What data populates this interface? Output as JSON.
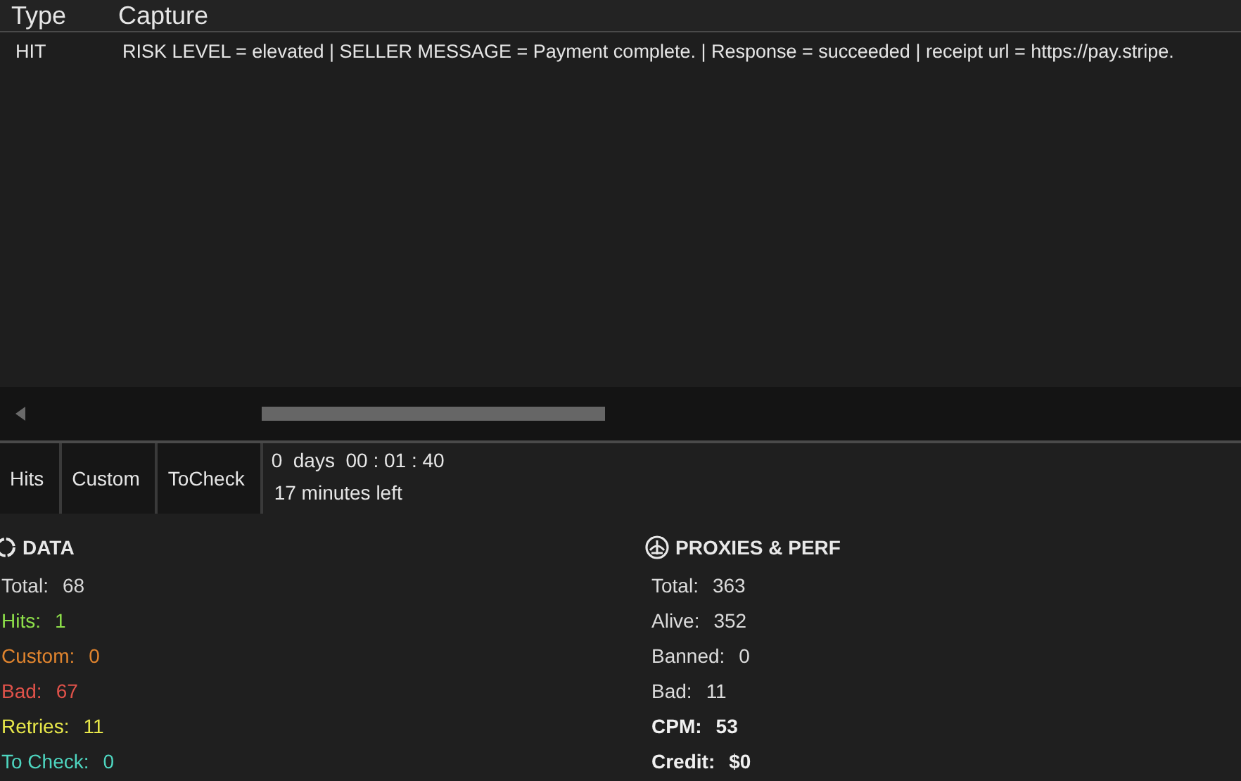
{
  "table": {
    "columns": [
      "Type",
      "Capture"
    ],
    "rows": [
      {
        "type": "HIT",
        "capture": "RISK LEVEL = elevated | SELLER MESSAGE = Payment complete. | Response = succeeded | receipt url = https://pay.stripe."
      }
    ]
  },
  "tabs": [
    "Hits",
    "Custom",
    "ToCheck"
  ],
  "timer": {
    "elapsed": "0  days  00 : 01 : 40",
    "remaining": "17 minutes left"
  },
  "data": {
    "title": "DATA",
    "stats": [
      {
        "label": "Total:",
        "value": "68",
        "color": "#d8d8d8"
      },
      {
        "label": "Hits:",
        "value": "1",
        "color": "#8ee04a"
      },
      {
        "label": "Custom:",
        "value": "0",
        "color": "#e0842e"
      },
      {
        "label": "Bad:",
        "value": "67",
        "color": "#e0524a"
      },
      {
        "label": "Retries:",
        "value": "11",
        "color": "#e8e84a"
      },
      {
        "label": "To Check:",
        "value": "0",
        "color": "#4ed6c0"
      }
    ]
  },
  "proxies": {
    "title": "PROXIES & PERF",
    "stats": [
      {
        "label": "Total:",
        "value": "363",
        "bold": false
      },
      {
        "label": "Alive:",
        "value": "352",
        "bold": false
      },
      {
        "label": "Banned:",
        "value": "0",
        "bold": false
      },
      {
        "label": "Bad:",
        "value": "11",
        "bold": false
      },
      {
        "label": "CPM:",
        "value": "53",
        "bold": true
      },
      {
        "label": "Credit:",
        "value": "$0",
        "bold": true
      }
    ]
  }
}
